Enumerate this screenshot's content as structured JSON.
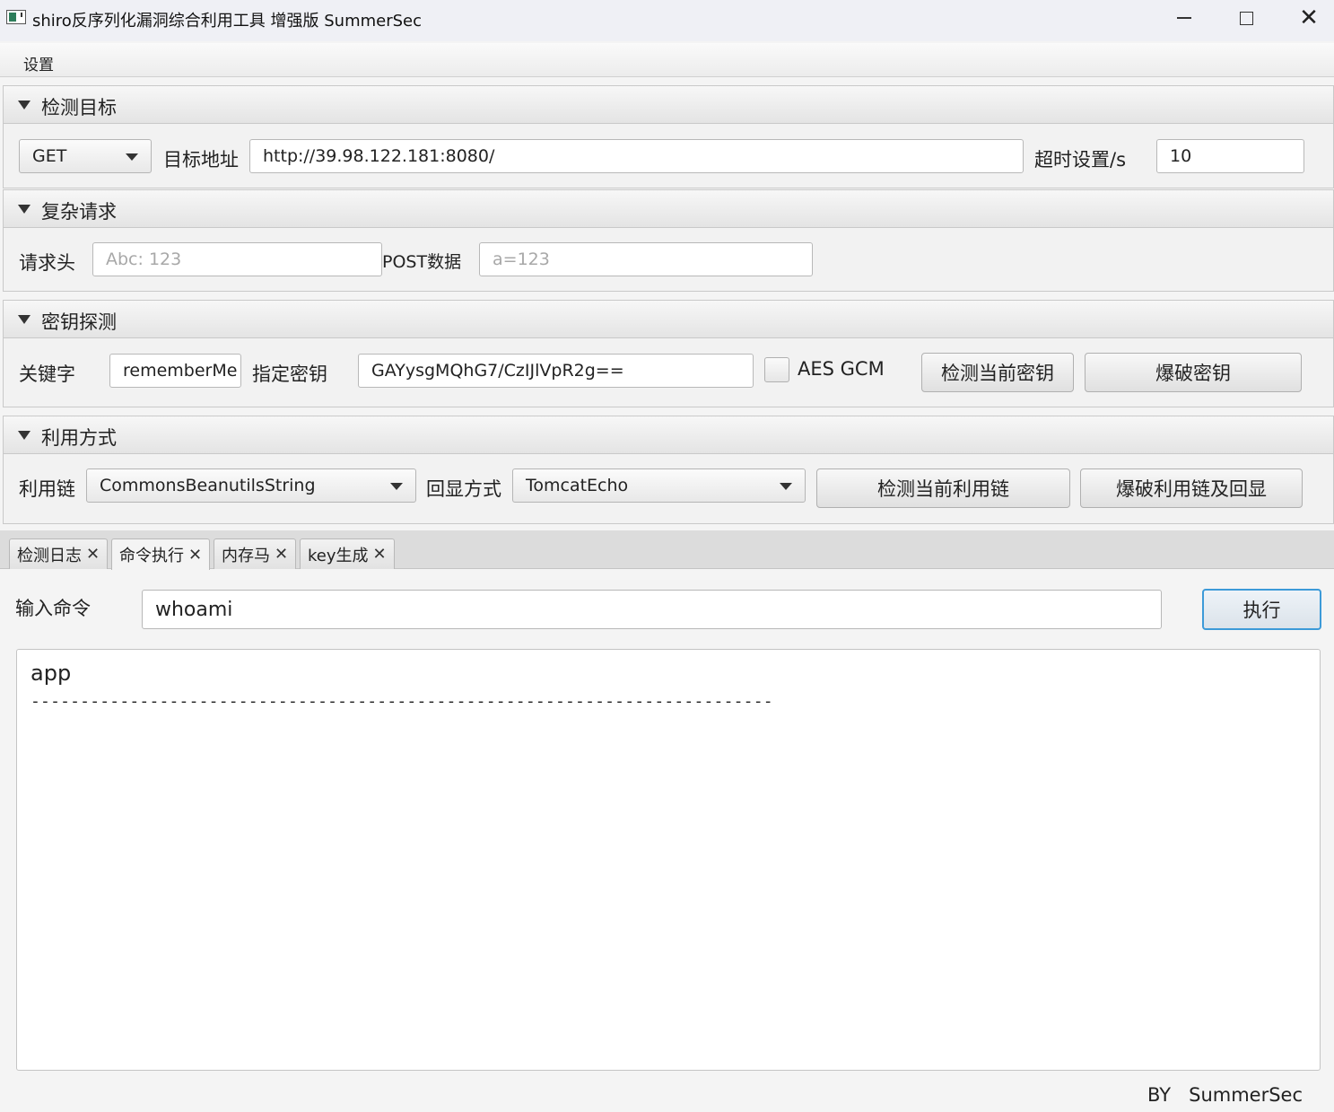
{
  "window": {
    "title": "shiro反序列化漏洞综合利用工具 增强版 SummerSec",
    "minimize": "—",
    "maximize": "□",
    "close": "✕"
  },
  "menu": {
    "settings": "设置"
  },
  "target": {
    "section_title": "检测目标",
    "method": "GET",
    "url_label": "目标地址",
    "url_value": "http://39.98.122.181:8080/",
    "timeout_label": "超时设置/s",
    "timeout_value": "10"
  },
  "complex": {
    "section_title": "复杂请求",
    "header_label": "请求头",
    "header_placeholder": "Abc: 123",
    "post_label": "POST数据",
    "post_placeholder": "a=123"
  },
  "key": {
    "section_title": "密钥探测",
    "keyword_label": "关键字",
    "keyword_value": "rememberMe",
    "specify_label": "指定密钥",
    "specify_value": "GAYysgMQhG7/CzIJlVpR2g==",
    "gcm_label": "AES GCM",
    "detect_button": "检测当前密钥",
    "brute_button": "爆破密钥"
  },
  "exploit": {
    "section_title": "利用方式",
    "chain_label": "利用链",
    "chain_value": "CommonsBeanutilsString",
    "echo_label": "回显方式",
    "echo_value": "TomcatEcho",
    "detect_button": "检测当前利用链",
    "brute_button": "爆破利用链及回显"
  },
  "tabs": [
    {
      "label": "检测日志",
      "close": "✕"
    },
    {
      "label": "命令执行",
      "close": "✕"
    },
    {
      "label": "内存马",
      "close": "✕"
    },
    {
      "label": "key生成",
      "close": "✕"
    }
  ],
  "command": {
    "label": "输入命令",
    "value": "whoami",
    "exec_button": "执行",
    "output_line1": "app",
    "output_line2": "---------------------------------------------------------------------------"
  },
  "footer": "BY   SummerSec"
}
